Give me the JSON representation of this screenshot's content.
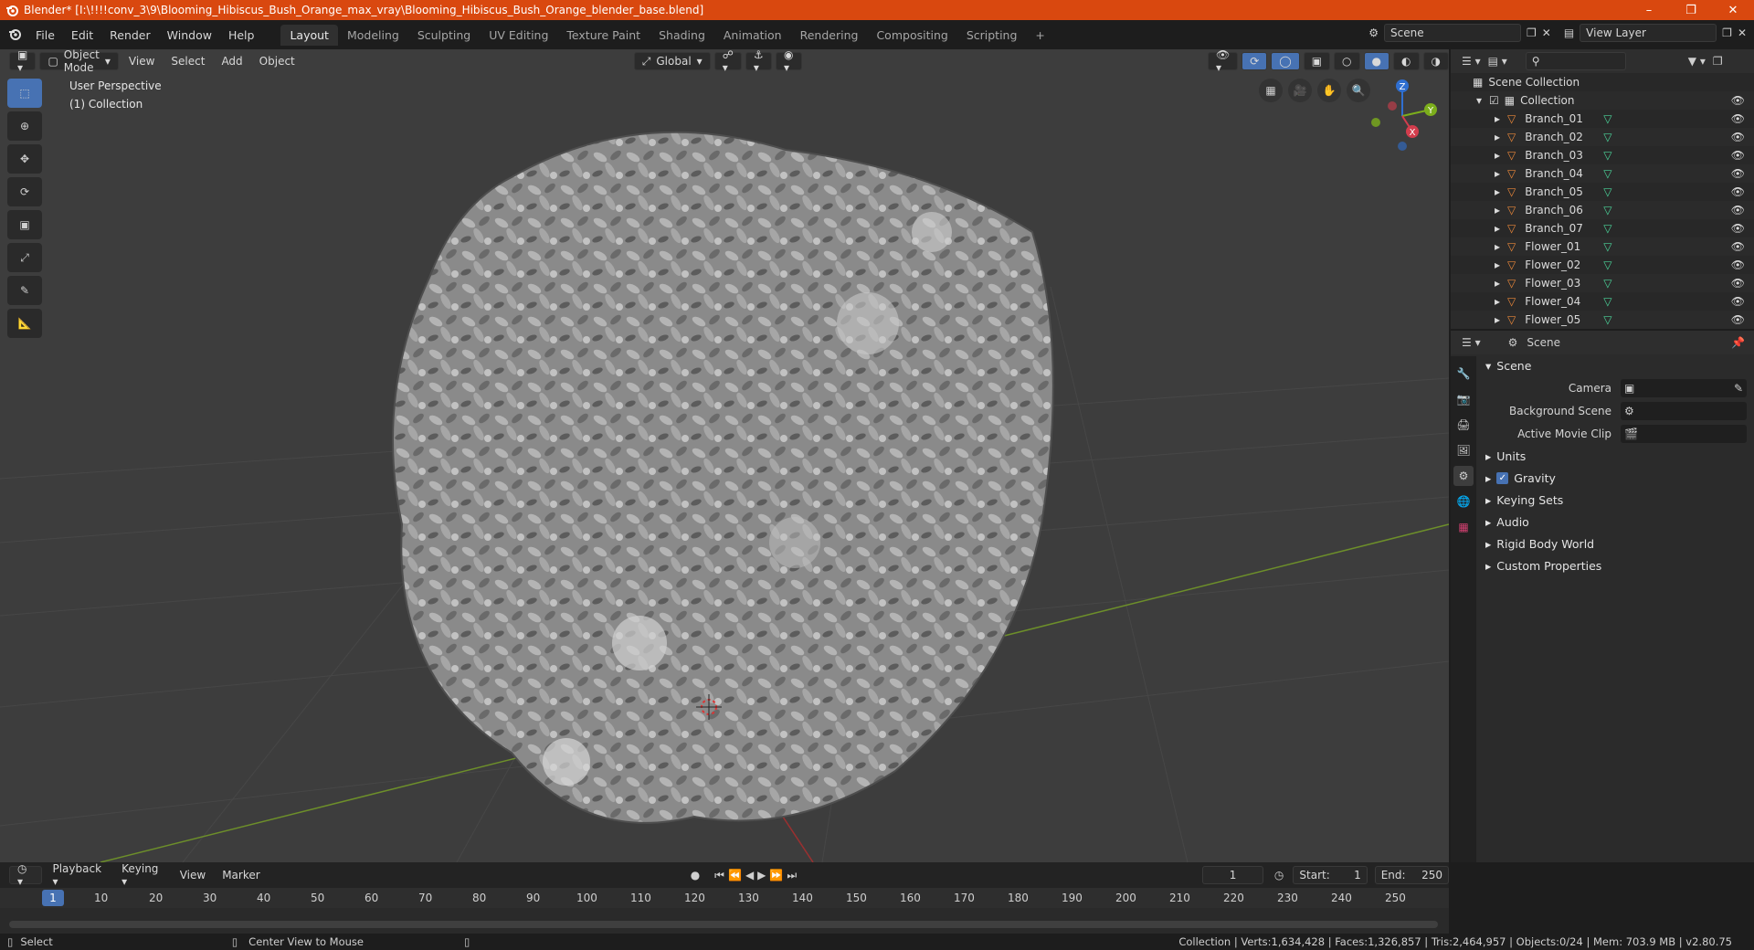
{
  "titlebar": {
    "title": "Blender* [I:\\!!!!conv_3\\9\\Blooming_Hibiscus_Bush_Orange_max_vray\\Blooming_Hibiscus_Bush_Orange_blender_base.blend]",
    "color": "#d9480f"
  },
  "menu": [
    "File",
    "Edit",
    "Render",
    "Window",
    "Help"
  ],
  "workspaces": [
    "Layout",
    "Modeling",
    "Sculpting",
    "UV Editing",
    "Texture Paint",
    "Shading",
    "Animation",
    "Rendering",
    "Compositing",
    "Scripting"
  ],
  "active_workspace": "Layout",
  "scene_name": "Scene",
  "view_layer": "View Layer",
  "viewport": {
    "mode": "Object Mode",
    "menus": [
      "View",
      "Select",
      "Add",
      "Object"
    ],
    "transform": "Global",
    "info_line1": "User Perspective",
    "info_line2": "(1) Collection",
    "gizmo": {
      "x": "X",
      "y": "Y",
      "z": "Z"
    }
  },
  "outliner": {
    "root": "Scene Collection",
    "collection": "Collection",
    "items": [
      "Branch_01",
      "Branch_02",
      "Branch_03",
      "Branch_04",
      "Branch_05",
      "Branch_06",
      "Branch_07",
      "Flower_01",
      "Flower_02",
      "Flower_03",
      "Flower_04",
      "Flower_05"
    ]
  },
  "properties": {
    "header": "Scene",
    "panel": "Scene",
    "fields": [
      {
        "label": "Camera",
        "value": ""
      },
      {
        "label": "Background Scene",
        "value": ""
      },
      {
        "label": "Active Movie Clip",
        "value": ""
      }
    ],
    "subpanels": [
      "Units",
      "Gravity",
      "Keying Sets",
      "Audio",
      "Rigid Body World",
      "Custom Properties"
    ],
    "gravity_checked": true
  },
  "timeline": {
    "menus": [
      "Playback",
      "Keying",
      "View",
      "Marker"
    ],
    "current_frame": "1",
    "start_label": "Start:",
    "start": "1",
    "end_label": "End:",
    "end": "250",
    "ticks": [
      "10",
      "20",
      "30",
      "40",
      "50",
      "60",
      "70",
      "80",
      "90",
      "100",
      "110",
      "120",
      "130",
      "140",
      "150",
      "160",
      "170",
      "180",
      "190",
      "200",
      "210",
      "220",
      "230",
      "240",
      "250"
    ],
    "indicator": "1"
  },
  "statusbar": {
    "left1": "Select",
    "left2": "Center View to Mouse",
    "right": "Collection | Verts:1,634,428 | Faces:1,326,857 | Tris:2,464,957 | Objects:0/24 | Mem: 703.9 MB | v2.80.75"
  }
}
